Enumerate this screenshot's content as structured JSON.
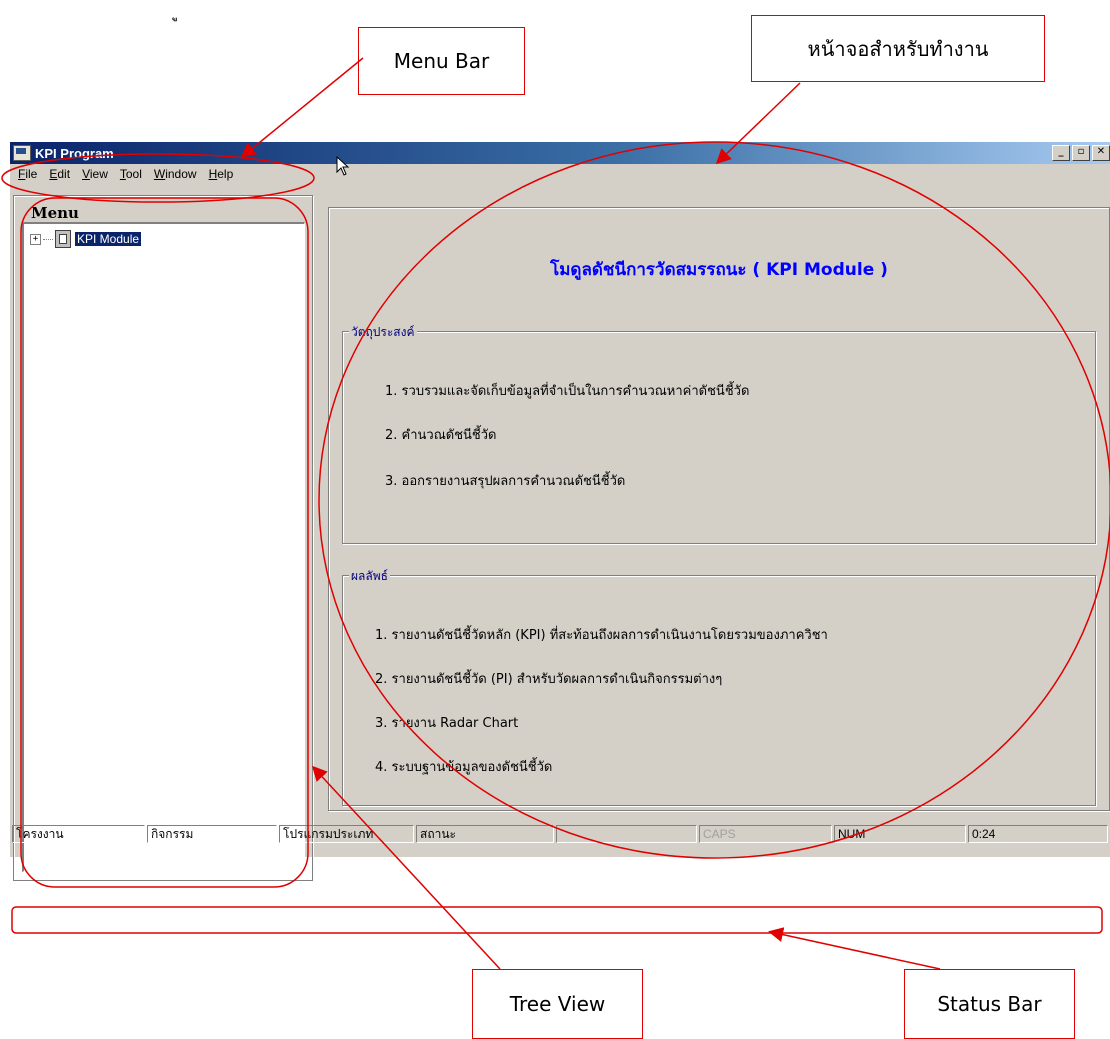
{
  "chapter_mark": "ู",
  "annotations": {
    "menu_bar": "Menu Bar",
    "work_area": "หน้าจอสำหรับทำงาน",
    "tree_view": "Tree View",
    "status_bar": "Status Bar"
  },
  "window": {
    "title": "KPI Program",
    "controls": {
      "minimize": "_",
      "restore": "▫",
      "close": "✕"
    }
  },
  "menubar": {
    "items": [
      {
        "label": "File",
        "accel": "F",
        "rest": "ile"
      },
      {
        "label": "Edit",
        "accel": "E",
        "rest": "dit"
      },
      {
        "label": "View",
        "accel": "V",
        "rest": "iew"
      },
      {
        "label": "Tool",
        "accel": "T",
        "rest": "ool"
      },
      {
        "label": "Window",
        "accel": "W",
        "rest": "indow"
      },
      {
        "label": "Help",
        "accel": "H",
        "rest": "elp"
      }
    ]
  },
  "tree": {
    "legend": "Menu",
    "expander": "+",
    "root_label": "KPI Module"
  },
  "main": {
    "title": "โมดูลดัชนีการวัดสมรรถนะ ( KPI Module )",
    "objectives": {
      "legend": "วัตถุประสงค์",
      "items": [
        "1.  รวบรวมและจัดเก็บข้อมูลที่จำเป็นในการคำนวณหาค่าดัชนีชี้วัด",
        "2.  คำนวณดัชนีชี้วัด",
        "3.  ออกรายงานสรุปผลการคำนวณดัชนีชี้วัด"
      ]
    },
    "results": {
      "legend": "ผลลัพธ์",
      "items": [
        "1.  รายงานดัชนีชี้วัดหลัก (KPI) ที่สะท้อนถึงผลการดำเนินงานโดยรวมของภาควิชา",
        "2.  รายงานดัชนีชี้วัด (PI) สำหรับวัดผลการดำเนินกิจกรรมต่างๆ",
        "3.  รายงาน Radar Chart",
        "4.  ระบบฐานข้อมูลของดัชนีชี้วัด"
      ]
    }
  },
  "statusbar": {
    "panes": [
      "โครงงาน",
      "กิจกรรม",
      "โปรแกรมประเภท",
      "สถานะ",
      "",
      "CAPS",
      "NUM",
      "0:24"
    ]
  },
  "colors": {
    "annotation_red": "#e00000",
    "title_blue": "#0000ff",
    "window_face": "#d4d0c8"
  }
}
